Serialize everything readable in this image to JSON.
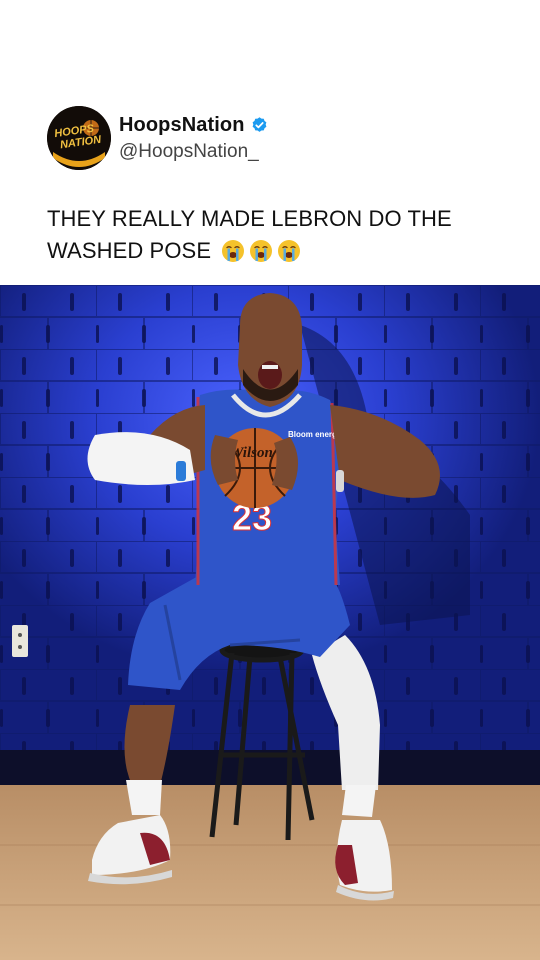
{
  "post": {
    "display_name": "HoopsNation",
    "handle": "@HoopsNation_",
    "verified": true,
    "caption": "THEY REALLY MADE LEBRON DO THE WASHED POSE",
    "emoji": [
      "loudly-crying-face-icon",
      "loudly-crying-face-icon",
      "loudly-crying-face-icon"
    ]
  },
  "avatar": {
    "logo_text_line1": "HOOPS",
    "logo_text_line2": "NATION"
  },
  "photo": {
    "ball_brand": "Wilson",
    "jersey_number": "23",
    "sponsor_patch": "Bloom energy"
  },
  "colors": {
    "wall_blue": "#2a3fd0",
    "jersey_blue": "#2f55c9",
    "floor": "#c8a27a",
    "verified_blue": "#1d9bf0"
  }
}
